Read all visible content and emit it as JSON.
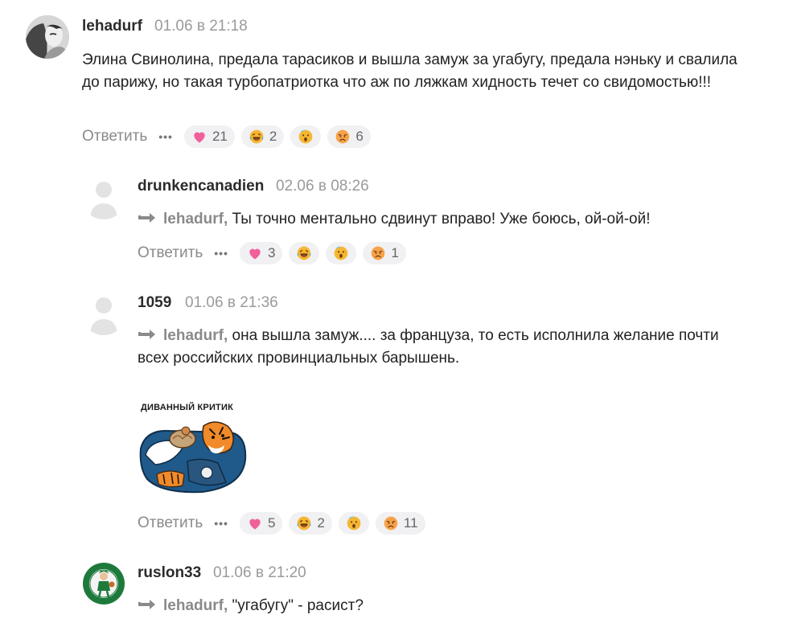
{
  "comments": [
    {
      "author": "lehadurf",
      "time": "01.06 в 21:18",
      "text": "Элина Свинолина, предала тарасиков и вышла замуж за угабугу, предала нэньку и свалила до парижу, но такая турбопатриотка что аж по ляжкам хидность течет со свидомостью!!!",
      "reply_label": "Ответить",
      "reactions": {
        "heart": "21",
        "laugh": "2",
        "shock": "",
        "sad": "6"
      }
    },
    {
      "author": "drunkencanadien",
      "time": "02.06 в 08:26",
      "reply_to": "lehadurf,",
      "text": "Ты точно ментально сдвинут вправо! Уже боюсь, ой-ой-ой!",
      "reply_label": "Ответить",
      "reactions": {
        "heart": "3",
        "laugh": "",
        "shock": "",
        "sad": "1"
      }
    },
    {
      "author": "1059",
      "time": "01.06 в 21:36",
      "reply_to": "lehadurf,",
      "text_line1": "она вышла замуж.... за француза, то есть исполнила желание почти",
      "text_line2": "всех российских провинциальных барышень.",
      "sticker_caption": "ДИВАННЫЙ КРИТИК",
      "reply_label": "Ответить",
      "reactions": {
        "heart": "5",
        "laugh": "2",
        "shock": "",
        "sad": "11"
      }
    },
    {
      "author": "ruslon33",
      "time": "01.06 в 21:20",
      "reply_to": "lehadurf,",
      "text": "\"угабугу\" - расист?",
      "avatar_logo_text": "BOSTON CELTICS"
    }
  ],
  "icons": {
    "more": "more-dots-icon",
    "heart": "heart-icon",
    "laugh": "laugh-emoji-icon",
    "shock": "shock-emoji-icon",
    "sad": "sad-emoji-icon",
    "reply_arrow": "reply-arrow-icon"
  },
  "colors": {
    "heart": "#f0609a",
    "emoji": "#f5b731",
    "text_muted": "#8a8a8a",
    "reaction_bg": "#f1f1f3"
  }
}
